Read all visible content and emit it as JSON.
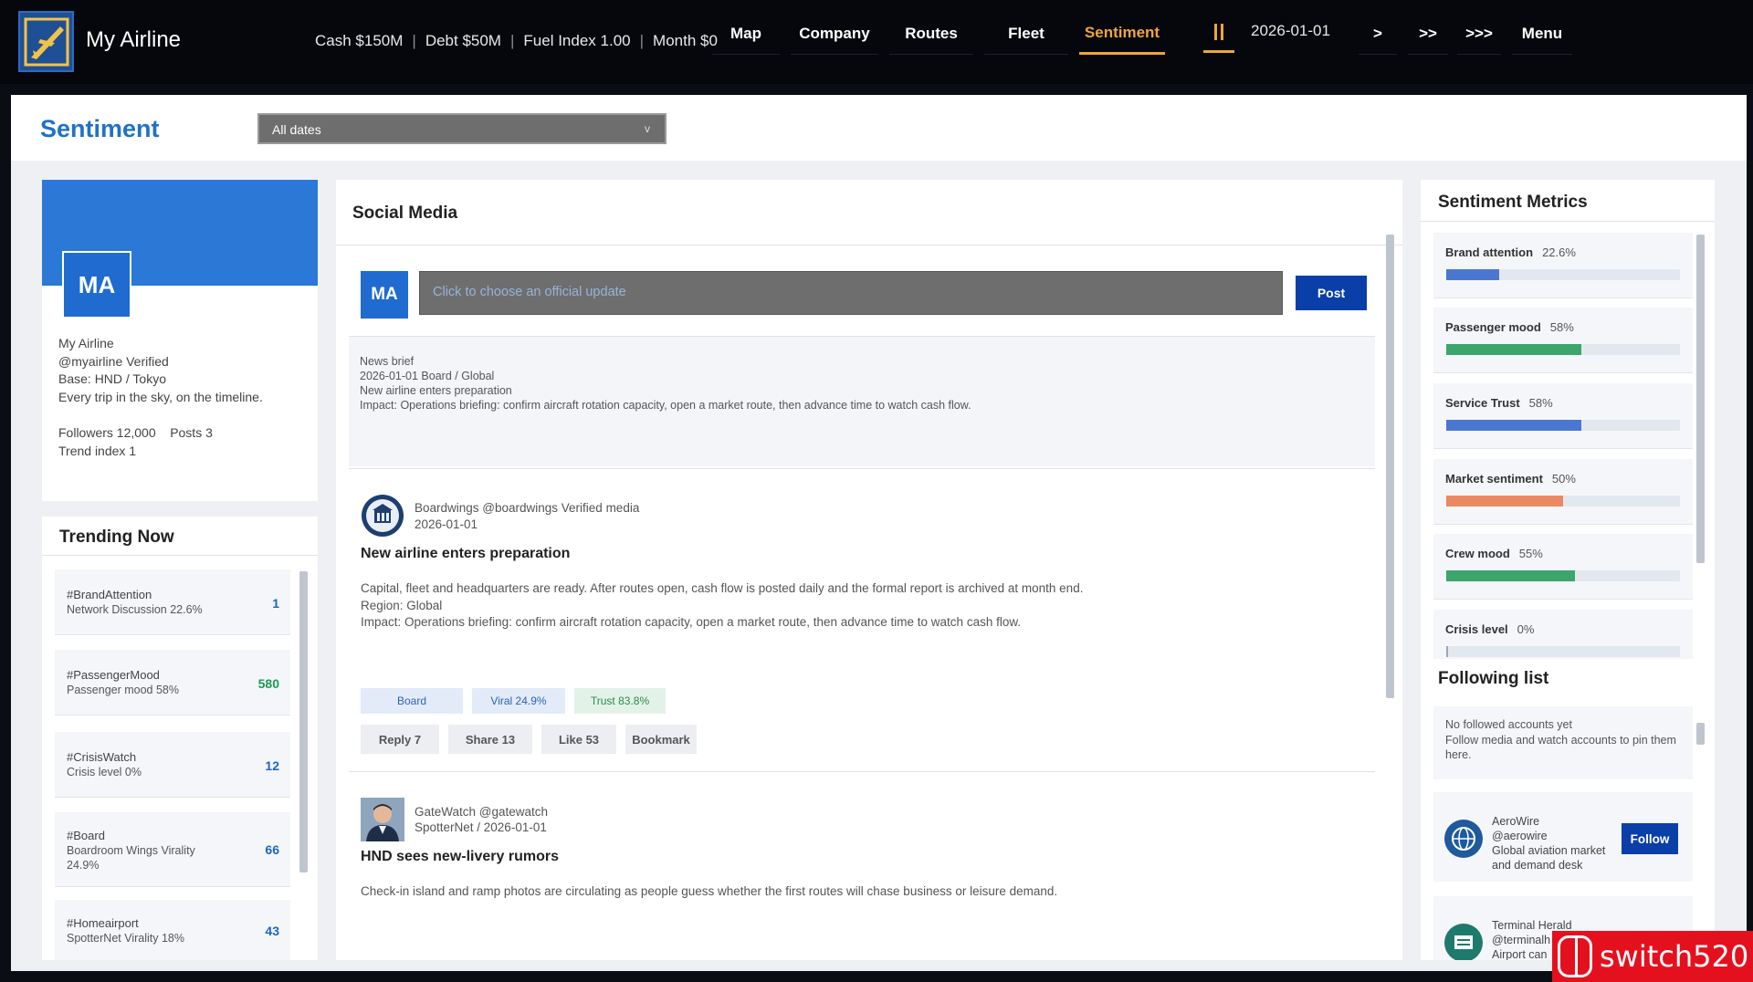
{
  "app": {
    "title": "My Airline"
  },
  "stats": {
    "cash": "Cash $150M",
    "debt": "Debt $50M",
    "fuel": "Fuel Index 1.00",
    "month": "Month $0",
    "separator": "|"
  },
  "nav": [
    {
      "label": "Map"
    },
    {
      "label": "Company"
    },
    {
      "label": "Routes"
    },
    {
      "label": "Fleet"
    },
    {
      "label": "Sentiment",
      "active": true
    }
  ],
  "time_controls": {
    "date": "2026-01-01",
    "speed1": ">",
    "speed2": ">>",
    "speed3": ">>>",
    "menu": "Menu"
  },
  "page": {
    "title": "Sentiment",
    "date_filter": "All dates",
    "chevron": "v"
  },
  "profile": {
    "avatar": "MA",
    "name": "My Airline",
    "handle": "@myairline  Verified",
    "base": "Base: HND / Tokyo",
    "tagline": "Every trip in the sky, on the timeline.",
    "followers": "Followers 12,000",
    "posts": "Posts 3",
    "trend": "Trend index 1"
  },
  "trending": {
    "title": "Trending Now",
    "items": [
      {
        "tag": "#BrandAttention",
        "desc": "Network Discussion 22.6%",
        "count": "1"
      },
      {
        "tag": "#PassengerMood",
        "desc": "Passenger mood 58%",
        "count": "580"
      },
      {
        "tag": "#CrisisWatch",
        "desc": "Crisis level 0%",
        "count": "12"
      },
      {
        "tag": "#Board",
        "desc": "Boardroom Wings  Virality 24.9%",
        "count": "66"
      },
      {
        "tag": "#Homeairport",
        "desc": "SpotterNet  Virality 18%",
        "count": "43"
      }
    ]
  },
  "feed": {
    "title": "Social Media",
    "compose": {
      "avatar": "MA",
      "placeholder": "Click to choose an official update",
      "post_label": "Post"
    },
    "brief": {
      "l1": "News brief",
      "l2": "2026-01-01  Board / Global",
      "l3": "New airline enters preparation",
      "l4": "Impact: Operations briefing: confirm aircraft rotation capacity, open a market route, then advance time to watch cash flow."
    },
    "posts": [
      {
        "author": "Boardwings  @boardwings  Verified media",
        "date": "2026-01-01",
        "title": "New airline enters preparation",
        "body1": "Capital, fleet and headquarters are ready. After routes open, cash flow is posted daily and the formal report is archived at month end.",
        "body2": "Region: Global",
        "body3": "Impact: Operations briefing: confirm aircraft rotation capacity, open a market route, then advance time to watch cash flow.",
        "tags": [
          "Board",
          "Viral 24.9%",
          "Trust 83.8%"
        ],
        "actions": [
          "Reply 7",
          "Share 13",
          "Like 53",
          "Bookmark"
        ]
      },
      {
        "author": "GateWatch  @gatewatch",
        "date": "SpotterNet / 2026-01-01",
        "title": "HND sees new-livery rumors",
        "body1": "Check-in island and ramp photos are circulating as people guess whether the first routes will chase business or leisure demand."
      }
    ]
  },
  "metrics": {
    "title": "Sentiment Metrics",
    "items": [
      {
        "label": "Brand attention",
        "pct_label": "22.6%",
        "value": 22.6,
        "color": "#4a77d1"
      },
      {
        "label": "Passenger mood",
        "pct_label": "58%",
        "value": 58,
        "color": "#3ba56b"
      },
      {
        "label": "Service Trust",
        "pct_label": "58%",
        "value": 58,
        "color": "#4a77d1"
      },
      {
        "label": "Market sentiment",
        "pct_label": "50%",
        "value": 50,
        "color": "#ea8a62"
      },
      {
        "label": "Crew mood",
        "pct_label": "55%",
        "value": 55,
        "color": "#3ba56b"
      },
      {
        "label": "Crisis level",
        "pct_label": "0%",
        "value": 0,
        "color": "#d9534f"
      }
    ]
  },
  "following": {
    "title": "Following list",
    "empty1": "No followed accounts yet",
    "empty2": "Follow media and watch accounts to pin them here.",
    "accounts": [
      {
        "name": "AeroWire",
        "handle": "@aerowire",
        "desc": "Global aviation market and demand desk",
        "button": "Follow"
      },
      {
        "name": "Terminal Herald",
        "handle": "@terminalh",
        "desc": "Airport can"
      }
    ]
  },
  "watermark": {
    "text": "switch520"
  },
  "colors": {
    "accent": "#f0a43b",
    "brand_blue": "#1f72c7",
    "button_blue": "#0a3fa9"
  }
}
